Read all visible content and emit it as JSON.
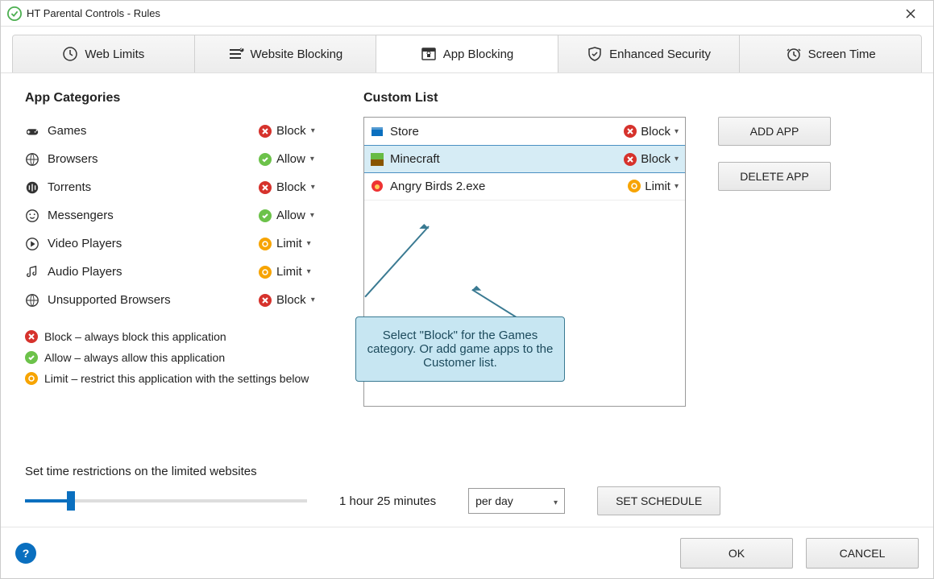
{
  "window": {
    "title": "HT Parental Controls - Rules"
  },
  "tabs": [
    {
      "label": "Web Limits",
      "active": false
    },
    {
      "label": "Website Blocking",
      "active": false
    },
    {
      "label": "App Blocking",
      "active": true
    },
    {
      "label": "Enhanced Security",
      "active": false
    },
    {
      "label": "Screen Time",
      "active": false
    }
  ],
  "sections": {
    "categories_title": "App Categories",
    "custom_title": "Custom List"
  },
  "categories": [
    {
      "icon": "gamepad",
      "label": "Games",
      "action": "Block",
      "kind": "block"
    },
    {
      "icon": "globe",
      "label": "Browsers",
      "action": "Allow",
      "kind": "allow"
    },
    {
      "icon": "torrent",
      "label": "Torrents",
      "action": "Block",
      "kind": "block"
    },
    {
      "icon": "chat",
      "label": "Messengers",
      "action": "Allow",
      "kind": "allow"
    },
    {
      "icon": "play",
      "label": "Video Players",
      "action": "Limit",
      "kind": "limit"
    },
    {
      "icon": "music",
      "label": "Audio Players",
      "action": "Limit",
      "kind": "limit"
    },
    {
      "icon": "globe",
      "label": "Unsupported Browsers",
      "action": "Block",
      "kind": "block"
    }
  ],
  "legend": {
    "block": "Block – always block this application",
    "allow": "Allow – always allow this application",
    "limit": "Limit – restrict this application with the settings below"
  },
  "custom_list": [
    {
      "icon": "store",
      "name": "Store",
      "action": "Block",
      "kind": "block",
      "selected": false
    },
    {
      "icon": "minecraft",
      "name": "Minecraft",
      "action": "Block",
      "kind": "block",
      "selected": true
    },
    {
      "icon": "angrybirds",
      "name": "Angry Birds 2.exe",
      "action": "Limit",
      "kind": "limit",
      "selected": false
    }
  ],
  "buttons": {
    "add_app": "ADD APP",
    "delete_app": "DELETE APP",
    "set_schedule": "SET SCHEDULE",
    "ok": "OK",
    "cancel": "CANCEL"
  },
  "time_restrict": {
    "label": "Set time restrictions on the limited websites",
    "duration_text": "1 hour 25 minutes",
    "period_selected": "per day"
  },
  "callout": {
    "text": "Select \"Block\" for the Games category. Or add game apps to the Customer list."
  }
}
